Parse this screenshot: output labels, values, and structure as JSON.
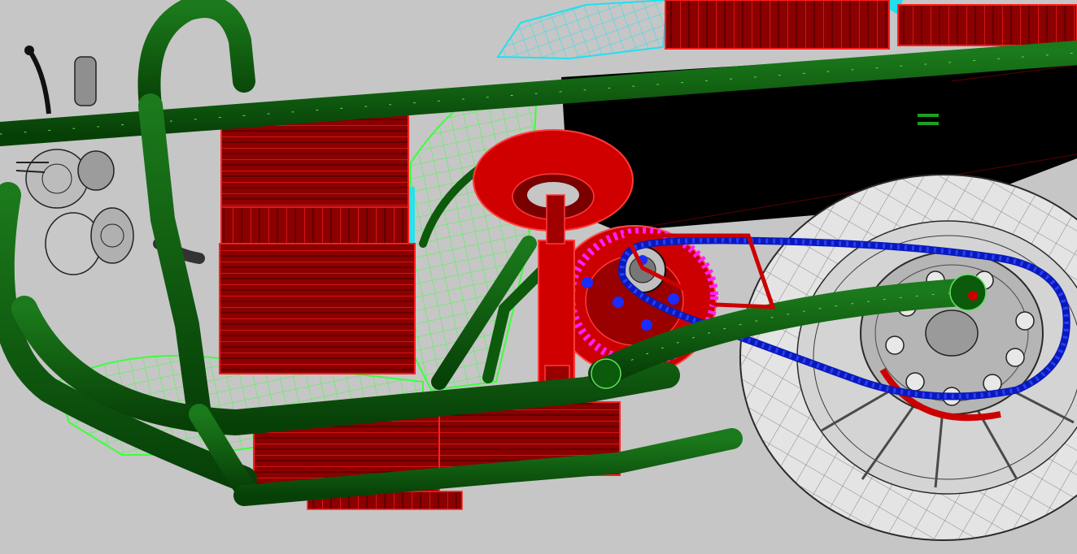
{
  "viewport": {
    "background": "#c6c6c6",
    "display_mode": "shaded-wireframe"
  },
  "colors": {
    "frame_tube": "#0c5a0c",
    "frame_edge": "#5fe05f",
    "battery_block": "#8b0000",
    "battery_edge": "#ff2020",
    "motor_housing": "#cc0000",
    "chain": "#0a1ab8",
    "chain_roller": "#2a3cff",
    "wheel_tire": "#e4e4e4",
    "wheel_mesh": "#555555",
    "rear_disc": "#b5b5b5",
    "fairing_mesh": "#3cff3c",
    "cyan_panel": "#20e0ee",
    "rear_body": "#000000",
    "motor_flange": "#ff20ff",
    "headlight_assembly": "#bcbcbc"
  },
  "model_parts": [
    "frame-tubes",
    "battery-pack-upper-left",
    "battery-pack-lower-left",
    "battery-pack-bottom",
    "battery-pack-top-rear",
    "rear-shock-absorber",
    "motor-with-sprocket",
    "drive-chain",
    "swingarm",
    "rear-wheel",
    "rear-sprocket-disc",
    "fairing-mesh",
    "rear-body-panel",
    "handlebar-grip",
    "headlight-cluster"
  ]
}
